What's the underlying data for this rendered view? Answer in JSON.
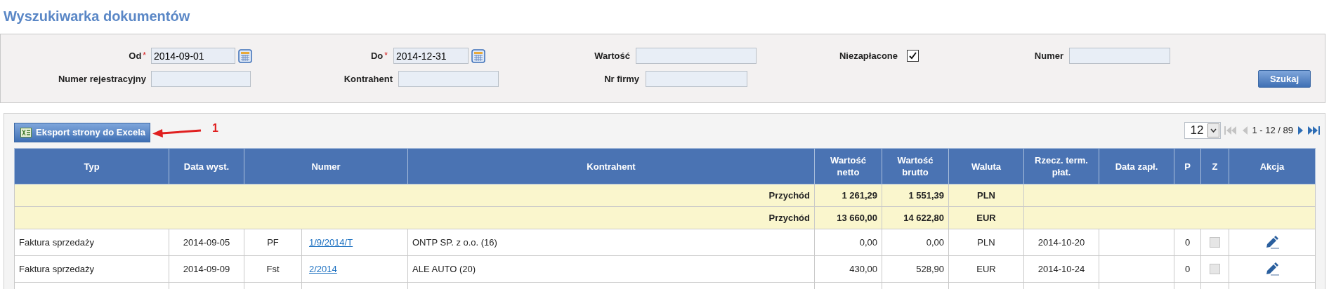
{
  "title": "Wyszukiwarka dokumentów",
  "filter_rows": [
    [
      {
        "kind": "date",
        "label": "Od",
        "required_mark": "*",
        "value": "2014-09-01"
      },
      {
        "kind": "date",
        "label": "Do",
        "required_mark": "*",
        "value": "2014-12-31"
      },
      {
        "kind": "text",
        "label": "Wartość"
      },
      {
        "kind": "checkbox",
        "label": "Niezapłacone",
        "checked": true
      },
      {
        "kind": "text",
        "label": "Numer"
      }
    ],
    [
      {
        "kind": "text",
        "label": "Numer rejestracyjny"
      },
      {
        "kind": "text",
        "label": "Kontrahent"
      },
      {
        "kind": "text",
        "label": "Nr firmy"
      }
    ]
  ],
  "search_button": "Szukaj",
  "export_button": "Eksport strony do Excela",
  "annotation": "1",
  "pager": {
    "page_size": "12",
    "range": "1 - 12 / 89",
    "first_disabled": true,
    "prev_disabled": true,
    "next_disabled": false,
    "last_disabled": false
  },
  "table": {
    "columns": [
      "Typ",
      "Data wyst.",
      "Numer",
      "Kontrahent",
      "Wartość netto",
      "Wartość brutto",
      "Waluta",
      "Rzecz. term. płat.",
      "Data zapł.",
      "P",
      "Z",
      "Akcja"
    ],
    "summary_rows": [
      {
        "label": "Przychód",
        "netto": "1 261,29",
        "brutto": "1 551,39",
        "currency": "PLN"
      },
      {
        "label": "Przychód",
        "netto": "13 660,00",
        "brutto": "14 622,80",
        "currency": "EUR"
      }
    ],
    "rows": [
      {
        "type": "Faktura sprzedaży",
        "date": "2014-09-05",
        "series": "PF",
        "number": "1/9/2014/T",
        "contractor": "ONTP SP. z o.o. (16)",
        "netto": "0,00",
        "brutto": "0,00",
        "currency": "PLN",
        "due": "2014-10-20",
        "p": "0",
        "z_checked": false,
        "z_disabled": true
      },
      {
        "type": "Faktura sprzedaży",
        "date": "2014-09-09",
        "series": "Fst",
        "number": "2/2014",
        "contractor": "ALE AUTO (20)",
        "netto": "430,00",
        "brutto": "528,90",
        "currency": "EUR",
        "due": "2014-10-24",
        "p": "0",
        "z_checked": false,
        "z_disabled": true
      }
    ]
  }
}
